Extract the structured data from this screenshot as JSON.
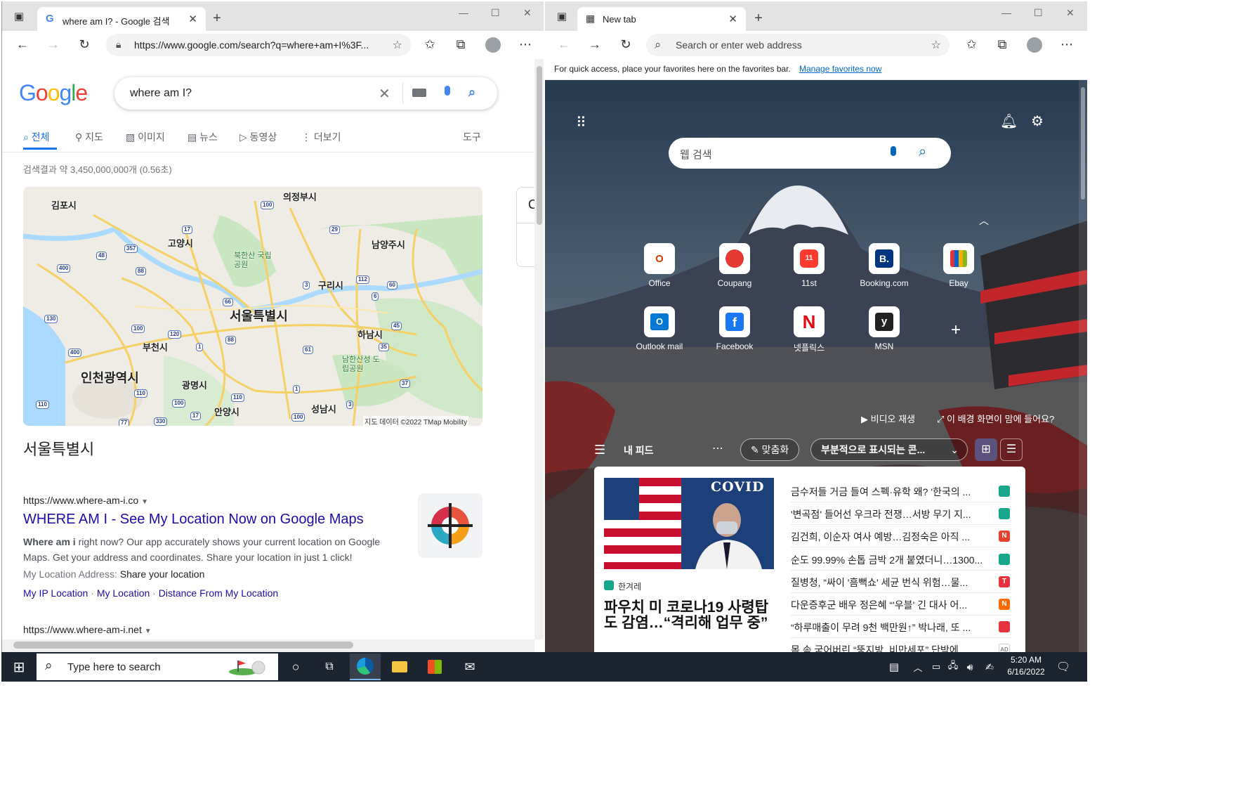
{
  "left_browser": {
    "tab_title": "where am I? - Google 검색",
    "url": "https://www.google.com/search?q=where+am+I%3F...",
    "google": {
      "logo": "Google",
      "query": "where am I?",
      "tabs": [
        "전체",
        "지도",
        "이미지",
        "뉴스",
        "동영상",
        "더보기"
      ],
      "tools": "도구",
      "result_stats": "검색결과 약 3,450,000,000개 (0.56초)",
      "side_card_letter": "C",
      "map": {
        "labels": [
          "의정부시",
          "김포시",
          "고양시",
          "남양주시",
          "북한산 국립공원",
          "구리시",
          "서울특별시",
          "하남시",
          "부천시",
          "인천광역시",
          "남한산성 도립공원",
          "광명시",
          "안양시",
          "성남시"
        ],
        "road_shields": [
          "100",
          "17",
          "29",
          "357",
          "48",
          "400",
          "88",
          "112",
          "60",
          "3",
          "6",
          "66",
          "130",
          "45",
          "100",
          "120",
          "88",
          "1",
          "35",
          "400",
          "61",
          "110",
          "1",
          "37",
          "110",
          "100",
          "110",
          "17",
          "3",
          "330",
          "77",
          "100"
        ],
        "attribution": "지도 데이터 ©2022 TMap Mobility"
      },
      "map_place_name": "서울특별시",
      "result1": {
        "site_url": "https://www.where-am-i.co",
        "title": "WHERE AM I - See My Location Now on Google Maps",
        "snippet_bold": "Where am i",
        "snippet_line1_rest": " right now? Our app accurately shows your current location on Google",
        "snippet_line2": "Maps. Get your address and coordinates. Share your location in just 1 click!",
        "address_label": "My Location Address: ",
        "address_value": "Share your location",
        "sitelinks": [
          "My IP Location",
          "My Location",
          "Distance From My Location"
        ]
      },
      "result2_url": "https://www.where-am-i.net"
    }
  },
  "right_browser": {
    "tab_title": "New tab",
    "address_placeholder": "Search or enter web address",
    "favorites_bar_text": "For quick access, place your favorites here on the favorites bar.",
    "favorites_bar_link": "Manage favorites now",
    "search_placeholder": "웹 검색",
    "quick_links": [
      {
        "label": "Office",
        "icon": "office-icon"
      },
      {
        "label": "Coupang",
        "icon": "coupang-icon"
      },
      {
        "label": "11st",
        "icon": "11st-icon"
      },
      {
        "label": "Booking.com",
        "icon": "booking-icon"
      },
      {
        "label": "Ebay",
        "icon": "ebay-icon"
      },
      {
        "label": "Outlook mail",
        "icon": "outlook-icon"
      },
      {
        "label": "Facebook",
        "icon": "facebook-icon"
      },
      {
        "label": "넷플릭스",
        "icon": "netflix-icon"
      },
      {
        "label": "MSN",
        "icon": "msn-icon"
      }
    ],
    "video_play": "비디오 재생",
    "like_background": "이 배경 화면이 맘에 들어요?",
    "feed": {
      "title": "내 피드",
      "personalize": "맞춤화",
      "content_filter": "부분적으로 표시되는 콘...",
      "hero_overlay": "COVID",
      "hero_source": "한겨레",
      "hero_headline_line1": "파우치 미 코로나19 사령탑",
      "hero_headline_line2": "도 감염…“격리해 업무 중”",
      "headlines": [
        "금수저들 거금 들여 스펙·유학 왜? '한국의 ...",
        "'변곡점' 들어선 우크라 전쟁…서방 무기 지...",
        "김건희, 이순자 여사 예방…김정숙은 아직 ...",
        "순도 99.99% 손톱 금박 2개 붙였더니…1300...",
        "질병청, “싸이 '흠뻑쇼' 세균 번식 위험…물...",
        "다운증후군 배우 정은혜 “'우블' 긴 대사 어...",
        "“하루매출이 무려 9천 백만원↑” 박나래, 또 ...",
        "몸 속 굳어버린 “뚱지방, 비만세포” 단박에 ..."
      ],
      "headline_badges": [
        "",
        "",
        "N",
        "",
        "T",
        "N",
        "",
        "AD"
      ],
      "badge_colors": [
        "#17a58c",
        "#17a58c",
        "#e8412b",
        "#17a58c",
        "#e5323e",
        "#ff6a00",
        "#e5323e",
        "#cccccc"
      ]
    }
  },
  "taskbar": {
    "search_placeholder": "Type here to search",
    "time": "5:20 AM",
    "date": "6/16/2022"
  },
  "colors": {
    "google_blue": "#4285f4",
    "google_red": "#ea4335",
    "google_yellow": "#fbbc05",
    "google_green": "#34a853",
    "link_blue": "#1a0dab",
    "taskbar": "#1c2430"
  }
}
